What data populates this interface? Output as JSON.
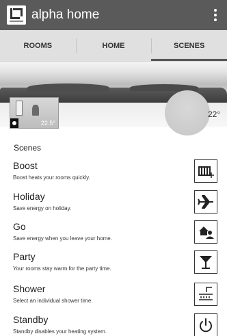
{
  "app": {
    "title": "alpha home"
  },
  "tabs": [
    {
      "label": "ROOMS",
      "active": false
    },
    {
      "label": "HOME",
      "active": false
    },
    {
      "label": "SCENES",
      "active": true
    }
  ],
  "hero": {
    "room_temperature": "22.5°",
    "outside_temperature": "22°"
  },
  "scenes": {
    "title": "Scenes",
    "items": [
      {
        "name": "Boost",
        "description": "Boost heats your rooms quickly.",
        "icon": "radiator-boost-icon"
      },
      {
        "name": "Holiday",
        "description": "Save energy on holiday.",
        "icon": "airplane-icon"
      },
      {
        "name": "Go",
        "description": "Save energy when you leave your home.",
        "icon": "leave-home-icon"
      },
      {
        "name": "Party",
        "description": "Your rooms stay warm for the party time.",
        "icon": "cocktail-glass-icon"
      },
      {
        "name": "Shower",
        "description": "Select an individual shower time.",
        "icon": "shower-icon"
      },
      {
        "name": "Standby",
        "description": "Standby disables your heating system.",
        "icon": "power-icon"
      }
    ]
  },
  "colors": {
    "appbar": "#5a5a5a",
    "tabbar": "#e0e0e0",
    "active_tab_indicator": "#555555"
  }
}
